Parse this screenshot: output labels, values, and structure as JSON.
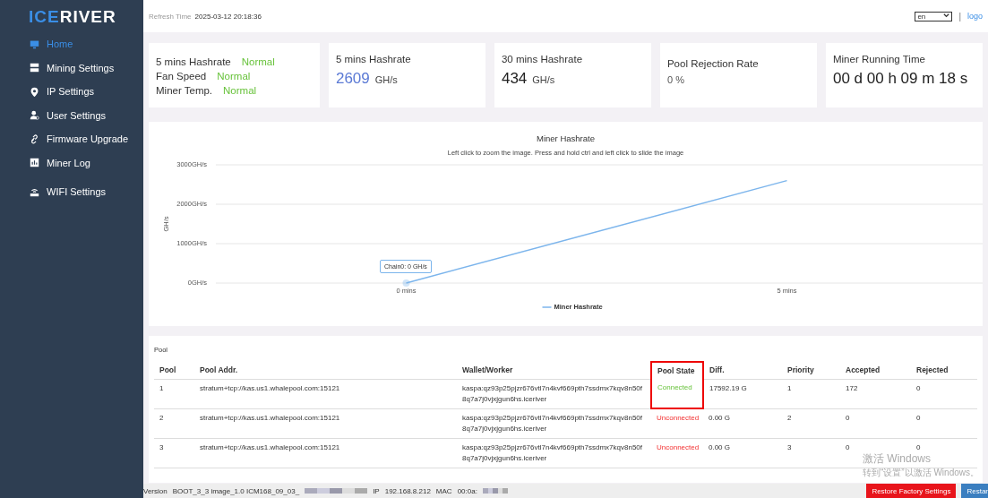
{
  "logo": {
    "accent": "ICE",
    "rest": "RIVER"
  },
  "sidebar": {
    "items": [
      {
        "label": "Home",
        "selected": true
      },
      {
        "label": "Mining Settings",
        "selected": false
      },
      {
        "label": "IP Settings",
        "selected": false
      },
      {
        "label": "User Settings",
        "selected": false
      },
      {
        "label": "Firmware Upgrade",
        "selected": false
      },
      {
        "label": "Miner Log",
        "selected": false
      },
      {
        "label": "WIFI Settings",
        "selected": false
      }
    ]
  },
  "topbar": {
    "refresh_label": "Refresh Time",
    "refresh_value": "2025-03-12 20:18:36",
    "language": "en",
    "separator": "|",
    "logout": "logo"
  },
  "status_card": {
    "rows": [
      {
        "label": "5 mins Hashrate",
        "status": "Normal"
      },
      {
        "label": "Fan Speed",
        "status": "Normal"
      },
      {
        "label": "Miner Temp.",
        "status": "Normal"
      }
    ]
  },
  "cards": [
    {
      "title": "5 mins Hashrate",
      "value": "2609",
      "unit": "GH/s",
      "kind": "accent"
    },
    {
      "title": "30 mins Hashrate",
      "value": "434",
      "unit": "GH/s",
      "kind": "large"
    },
    {
      "title": "Pool Rejection Rate",
      "value": "0 %",
      "kind": "small"
    },
    {
      "title": "Miner Running Time",
      "value": "00 d 00 h 09 m 18 s",
      "kind": "large"
    }
  ],
  "chart": {
    "hint": "Left click to zoom the image. Press and hold ctrl and left click to slide the image",
    "tooltip": "Chain0: 0 GH/s",
    "chart_data": {
      "type": "line",
      "title": "Miner Hashrate",
      "ylabel": "GH/s",
      "categories": [
        "0 mins",
        "5 mins"
      ],
      "ylim": [
        0,
        3000
      ],
      "yticks": [
        {
          "value": 0,
          "label": "0GH/s"
        },
        {
          "value": 1000,
          "label": "1000GH/s"
        },
        {
          "value": 2000,
          "label": "2000GH/s"
        },
        {
          "value": 3000,
          "label": "3000GH/s"
        }
      ],
      "series": [
        {
          "name": "Miner Hashrate",
          "color": "#7cb5ec",
          "values": [
            0,
            2600
          ]
        }
      ]
    }
  },
  "pool": {
    "title": "Pool",
    "columns": [
      {
        "label": "Pool",
        "highlighted": false
      },
      {
        "label": "Pool Addr.",
        "highlighted": false
      },
      {
        "label": "Wallet/Worker",
        "highlighted": false
      },
      {
        "label": "Pool State",
        "highlighted": true
      },
      {
        "label": "Diff.",
        "highlighted": false
      },
      {
        "label": "Priority",
        "highlighted": false
      },
      {
        "label": "Accepted",
        "highlighted": false
      },
      {
        "label": "Rejected",
        "highlighted": false
      }
    ],
    "rows": [
      {
        "pool": "1",
        "addr": "stratum+tcp://kas.us1.whalepool.com:15121",
        "wallet": "kaspa:qz93p25pjzr676vtl7n4kvf669pth7ssdmx7kqv8n50f8q7a7j0vjxjgun6hs.iceriver",
        "state": "Connected",
        "connected": true,
        "state_highlighted": true,
        "diff": "17592.19 G",
        "priority": "1",
        "accepted": "172",
        "rejected": "0"
      },
      {
        "pool": "2",
        "addr": "stratum+tcp://kas.us1.whalepool.com:15121",
        "wallet": "kaspa:qz93p25pjzr676vtl7n4kvf669pth7ssdmx7kqv8n50f8q7a7j0vjxjgun6hs.iceriver",
        "state": "Unconnected",
        "connected": false,
        "state_highlighted": false,
        "diff": "0.00 G",
        "priority": "2",
        "accepted": "0",
        "rejected": "0"
      },
      {
        "pool": "3",
        "addr": "stratum+tcp://kas.us1.whalepool.com:15121",
        "wallet": "kaspa:qz93p25pjzr676vtl7n4kvf669pth7ssdmx7kqv8n50f8q7a7j0vjxjgun6hs.iceriver",
        "state": "Unconnected",
        "connected": false,
        "state_highlighted": false,
        "diff": "0.00 G",
        "priority": "3",
        "accepted": "0",
        "rejected": "0"
      }
    ]
  },
  "activation": {
    "title": "激活 Windows",
    "hint": "转到“设置”以激活 Windows。"
  },
  "footer": {
    "version_label": "Version",
    "version": "BOOT_3_3 image_1.0 ICM168_09_03_",
    "ip_label": "IP",
    "ip": "192.168.8.212",
    "mac_label": "MAC",
    "mac": "00:0a:",
    "buttons": [
      {
        "label": "Restore Factory Settings",
        "kind": "danger"
      },
      {
        "label": "Restar",
        "kind": "primary"
      }
    ]
  }
}
